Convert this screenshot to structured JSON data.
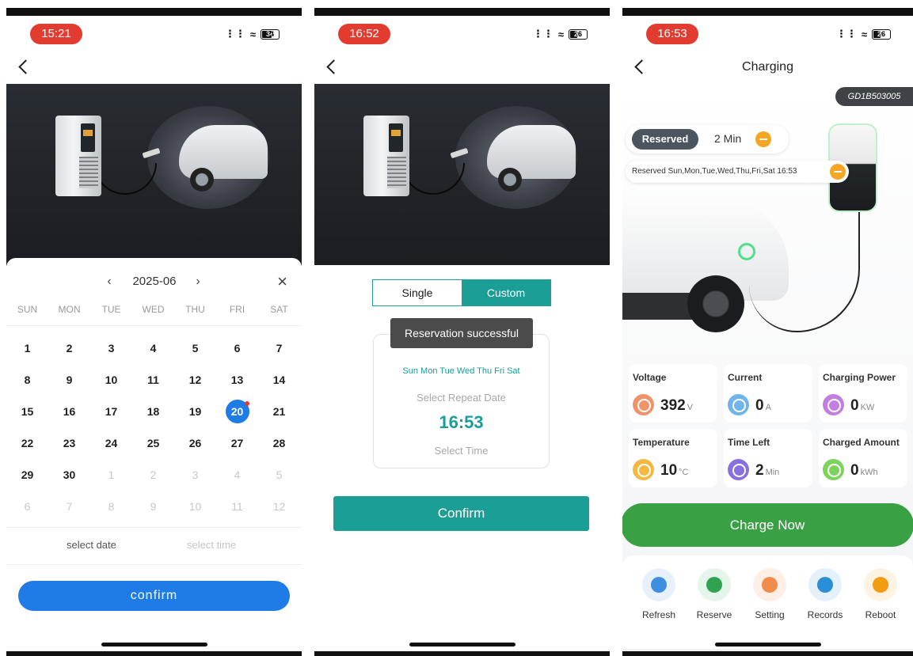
{
  "phone1": {
    "status_time": "15:21",
    "battery": "34",
    "calendar": {
      "month": "2025-06",
      "weekdays": [
        "SUN",
        "MON",
        "TUE",
        "WED",
        "THU",
        "FRI",
        "SAT"
      ],
      "weeks": [
        [
          "1",
          "2",
          "3",
          "4",
          "5",
          "6",
          "7"
        ],
        [
          "8",
          "9",
          "10",
          "11",
          "12",
          "13",
          "14"
        ],
        [
          "15",
          "16",
          "17",
          "18",
          "19",
          "20",
          "21"
        ],
        [
          "22",
          "23",
          "24",
          "25",
          "26",
          "27",
          "28"
        ],
        [
          "29",
          "30",
          "1",
          "2",
          "3",
          "4",
          "5"
        ],
        [
          "6",
          "7",
          "8",
          "9",
          "10",
          "11",
          "12"
        ]
      ],
      "selected_day": "20"
    },
    "select_date": "select date",
    "select_time": "select time",
    "confirm_label": "confirm"
  },
  "phone2": {
    "status_time": "16:52",
    "battery": "26",
    "tabs": [
      "Single",
      "Custom"
    ],
    "active_tab": "Custom",
    "toast": "Reservation successful",
    "repeat_days": "Sun Mon Tue Wed Thu Fri Sat",
    "repeat_label": "Select Repeat Date",
    "time_value": "16:53",
    "time_label": "Select Time",
    "confirm_label": "Confirm"
  },
  "phone3": {
    "status_time": "16:53",
    "battery": "26",
    "title": "Charging",
    "serial": "GD1B503005",
    "reserved_tag": "Reserved",
    "reserved_time": "2 Min",
    "schedule_text": "Reserved Sun,Mon,Tue,Wed,Thu,Fri,Sat 16:53",
    "metrics": [
      {
        "label": "Voltage",
        "value": "392",
        "unit": "V",
        "color": "#f0936a"
      },
      {
        "label": "Current",
        "value": "0",
        "unit": "A",
        "color": "#6fb5e8"
      },
      {
        "label": "Charging Power",
        "value": "0",
        "unit": "KW",
        "color": "#c27fe0"
      },
      {
        "label": "Temperature",
        "value": "10",
        "unit": "°C",
        "color": "#f5b942"
      },
      {
        "label": "Time Left",
        "value": "2",
        "unit": "Min",
        "color": "#8a6fe0"
      },
      {
        "label": "Charged Amount",
        "value": "0",
        "unit": "kWh",
        "color": "#7dd35b"
      }
    ],
    "charge_now": "Charge Now",
    "tools": [
      {
        "label": "Refresh",
        "icon": "refresh-icon",
        "color": "#3f8fe0",
        "bg": "#e8f1fb"
      },
      {
        "label": "Reserve",
        "icon": "clock-icon",
        "color": "#2fa352",
        "bg": "#e6f5ea"
      },
      {
        "label": "Setting",
        "icon": "gear-icon",
        "color": "#f08c4c",
        "bg": "#fdefe5"
      },
      {
        "label": "Records",
        "icon": "document-icon",
        "color": "#2b8fd6",
        "bg": "#e5f1fa"
      },
      {
        "label": "Reboot",
        "icon": "warning-icon",
        "color": "#f39c12",
        "bg": "#fdf3e2"
      }
    ]
  }
}
